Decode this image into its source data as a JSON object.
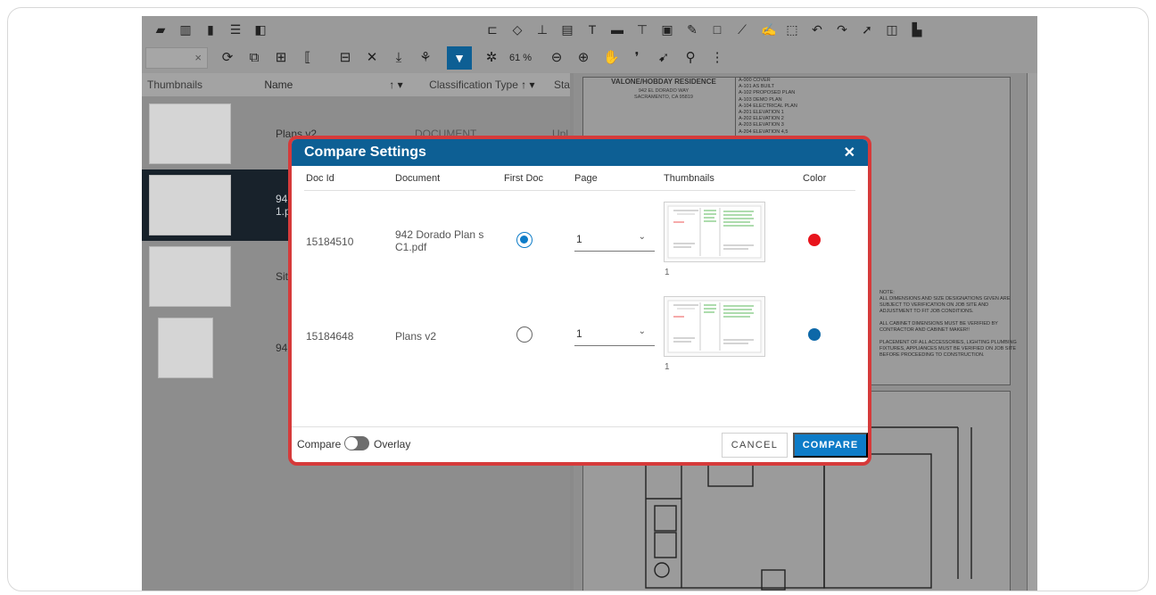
{
  "toolbar": {
    "search_clear": "×",
    "zoom_label": "61 %"
  },
  "list": {
    "headers": {
      "thumbnails": "Thumbnails",
      "name": "Name",
      "classification": "Classification Type",
      "status": "Sta"
    },
    "rows": [
      {
        "name": "Plans v2",
        "type": "DOCUMENT",
        "status": "Upl"
      },
      {
        "name": "942\n1.pdf",
        "type": ""
      },
      {
        "name": "Site",
        "type": ""
      },
      {
        "name": "942",
        "type": ""
      }
    ]
  },
  "doc": {
    "title_block": "VALONE/HOBDAY RESIDENCE",
    "address1": "942 EL DORADO WAY",
    "address2": "SACRAMENTO, CA 95819",
    "sheet_index": [
      "A-000  COVER",
      "A-101  AS BUILT",
      "A-102  PROPOSED PLAN",
      "A-103  DEMO PLAN",
      "A-104  ELECTRICAL PLAN",
      "A-201  ELEVATION 1",
      "A-202  ELEVATION 2",
      "A-203  ELEVATION 3",
      "A-204  ELEVATION 4,5"
    ],
    "notes": "NOTE:\nALL DIMENSIONS AND SIZE DESIGNATIONS GIVEN ARE SUBJECT TO VERIFICATION ON JOB SITE AND ADJUSTMENT TO FIT JOB CONDITIONS.\n\nALL CABINET DIMENSIONS MUST BE VERIFIED BY CONTRACTOR AND CABINET MAKER!!\n\nPLACEMENT OF ALL ACCESSORIES, LIGHTING PLUMBING FIXTURES, APPLIANCES MUST BE VERIFIED ON JOB SITE BEFORE PROCEEDING TO CONSTRUCTION."
  },
  "modal": {
    "title": "Compare Settings",
    "close": "✕",
    "columns": {
      "doc_id": "Doc Id",
      "document": "Document",
      "first_doc": "First Doc",
      "page": "Page",
      "thumbnails": "Thumbnails",
      "color": "Color"
    },
    "rows": [
      {
        "doc_id": "15184510",
        "document": "942 Dorado Plan s C1.pdf",
        "first_doc": true,
        "page": "1",
        "thumb_page": "1",
        "color": "#e8141c"
      },
      {
        "doc_id": "15184648",
        "document": "Plans v2",
        "first_doc": false,
        "page": "1",
        "thumb_page": "1",
        "color": "#0d68a8"
      }
    ],
    "footer": {
      "compare_label": "Compare",
      "overlay_label": "Overlay",
      "cancel": "CANCEL",
      "compare_btn": "COMPARE"
    }
  },
  "colors": {
    "accent": "#0d5f94",
    "primary_button": "#0d7cc8",
    "modal_border": "#d63a3a"
  }
}
